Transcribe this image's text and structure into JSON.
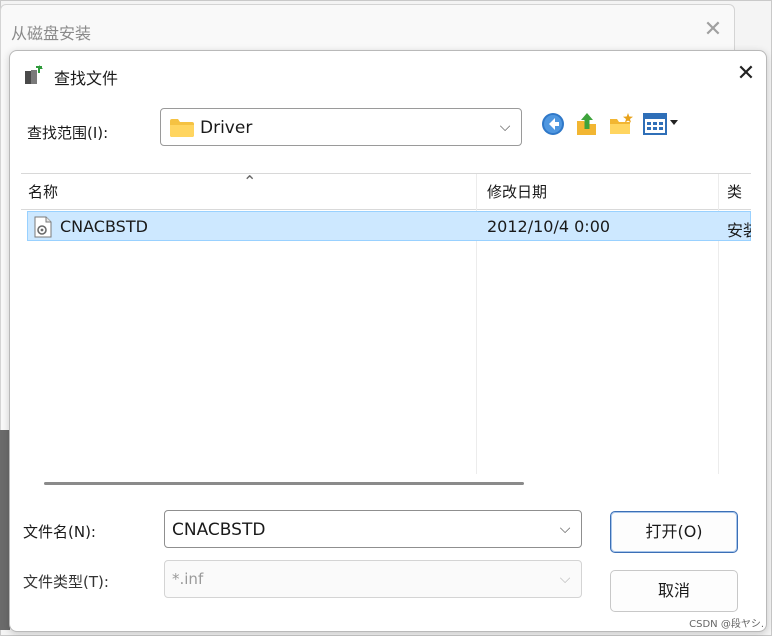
{
  "background_window": {
    "title": "从磁盘安装",
    "close_glyph": "✕"
  },
  "dialog": {
    "title": "查找文件",
    "close_glyph": "✕",
    "lookin_label": "查找范围(I):",
    "lookin_value": "Driver",
    "toolbar": {
      "icons": [
        "back-icon",
        "up-folder-icon",
        "new-folder-icon",
        "view-menu-icon"
      ]
    },
    "columns": [
      {
        "label": "名称"
      },
      {
        "label": "修改日期"
      },
      {
        "label": "类型"
      }
    ],
    "files": [
      {
        "name": "CNACBSTD",
        "modified": "2012/10/4 0:00",
        "type": "安装信息",
        "selected": true
      }
    ],
    "filename_label": "文件名(N):",
    "filename_value": "CNACBSTD",
    "filetype_label": "文件类型(T):",
    "filetype_value": "*.inf",
    "open_button": "打开(O)",
    "cancel_button": "取消"
  },
  "watermark": "CSDN @段ヤシ.",
  "colors": {
    "selection": "#cde8ff",
    "selection_border": "#99d1ff",
    "primary_border": "#3b6fb6"
  }
}
